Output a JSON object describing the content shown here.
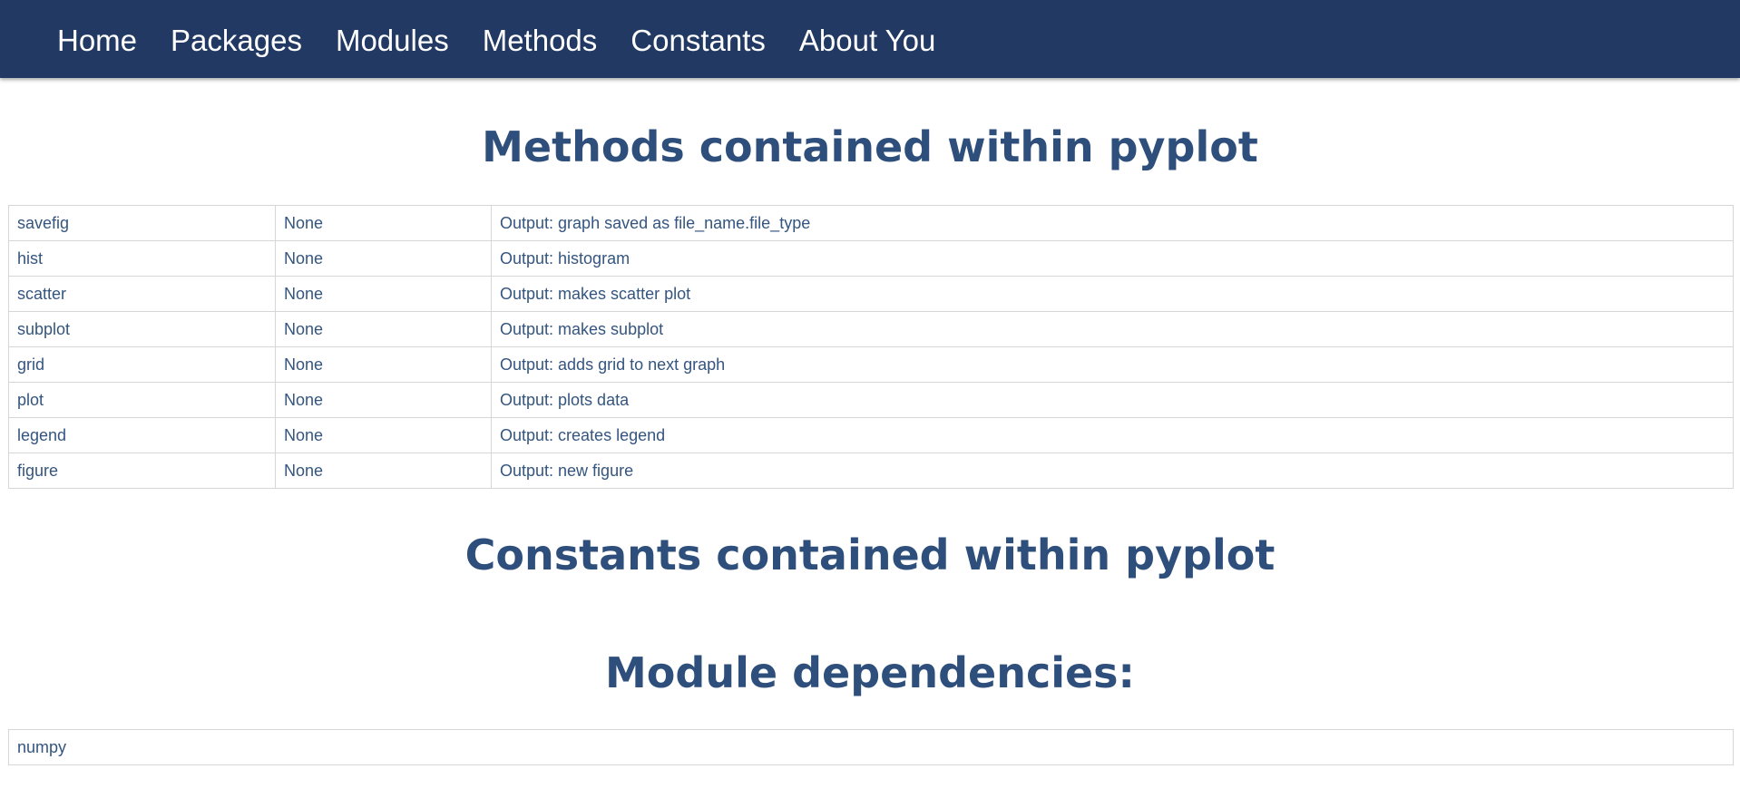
{
  "nav": {
    "items": [
      {
        "label": "Home"
      },
      {
        "label": "Packages"
      },
      {
        "label": "Modules"
      },
      {
        "label": "Methods"
      },
      {
        "label": "Constants"
      },
      {
        "label": "About You"
      }
    ]
  },
  "methods": {
    "title": "Methods contained within pyplot",
    "rows": [
      {
        "name": "savefig",
        "params": "None",
        "output": "Output: graph saved as file_name.file_type"
      },
      {
        "name": "hist",
        "params": "None",
        "output": "Output: histogram"
      },
      {
        "name": "scatter",
        "params": "None",
        "output": "Output: makes scatter plot"
      },
      {
        "name": "subplot",
        "params": "None",
        "output": "Output: makes subplot"
      },
      {
        "name": "grid",
        "params": "None",
        "output": "Output: adds grid to next graph"
      },
      {
        "name": "plot",
        "params": "None",
        "output": "Output: plots data"
      },
      {
        "name": "legend",
        "params": "None",
        "output": "Output: creates legend"
      },
      {
        "name": "figure",
        "params": "None",
        "output": "Output: new figure"
      }
    ]
  },
  "constants": {
    "title": "Constants contained within pyplot"
  },
  "dependencies": {
    "title": "Module dependencies:",
    "rows": [
      {
        "name": "numpy"
      }
    ]
  },
  "colors": {
    "navbar": "#223a63",
    "heading": "#2e4f7b",
    "text": "#34557f"
  }
}
